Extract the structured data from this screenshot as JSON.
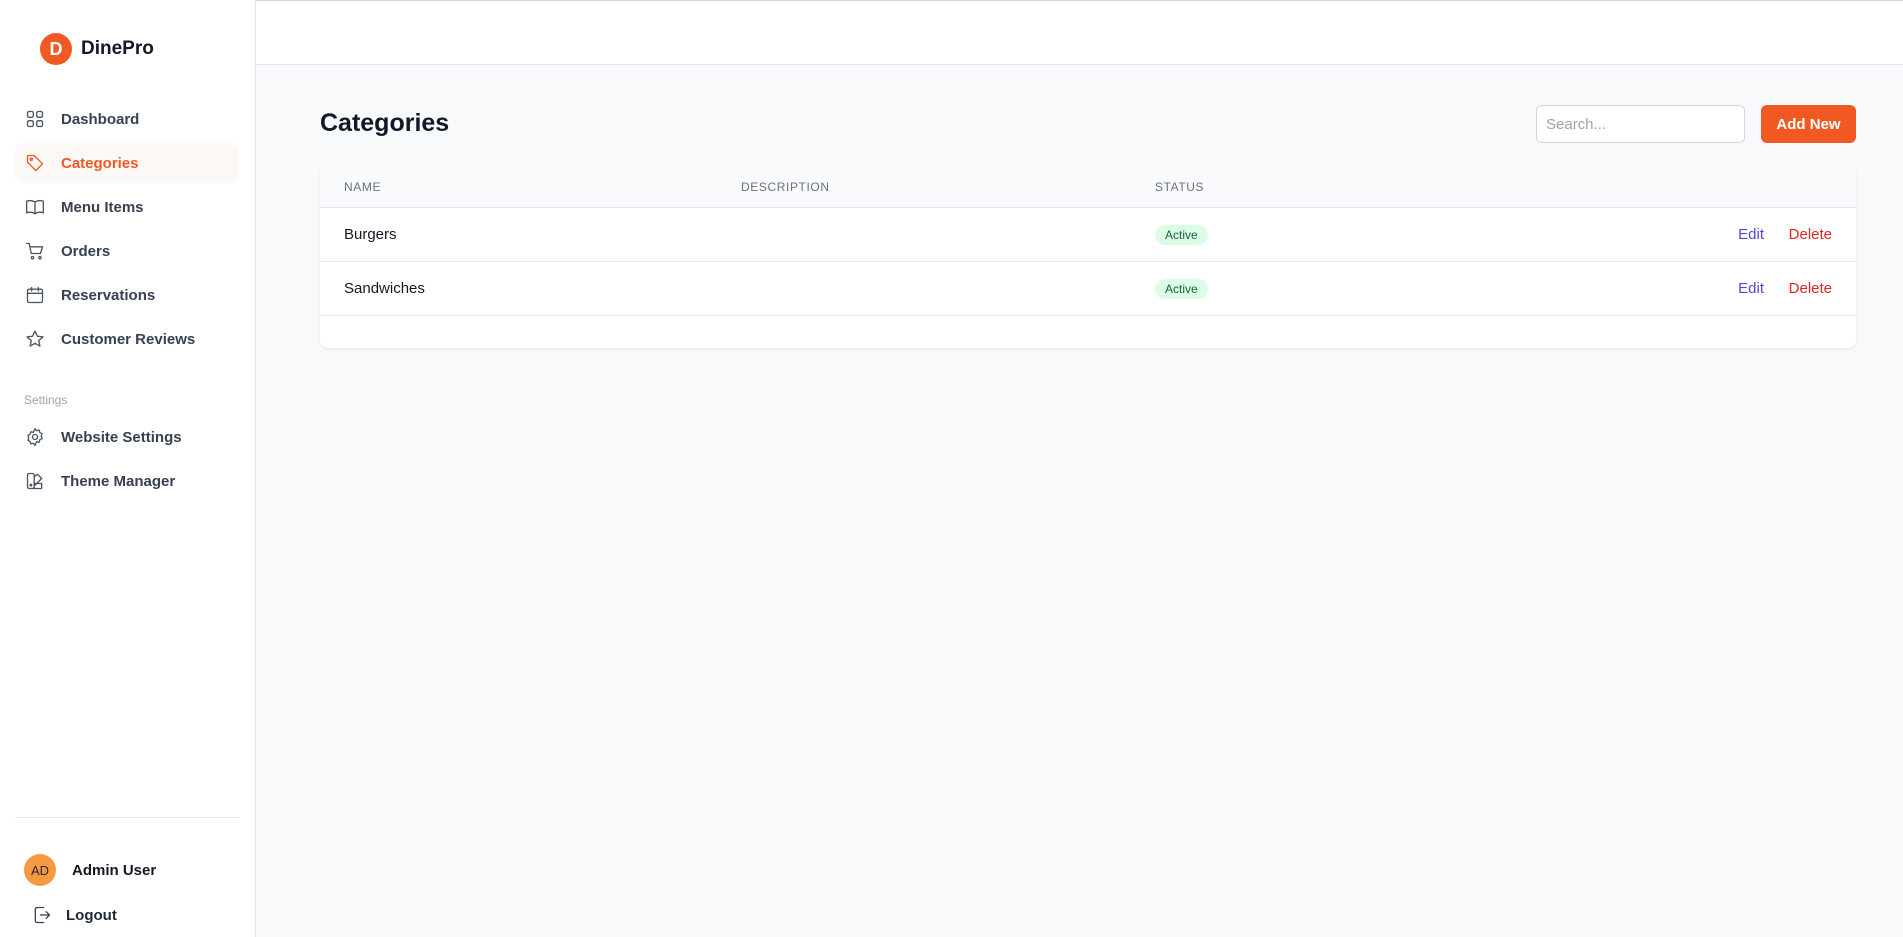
{
  "brand": {
    "logo_letter": "D",
    "name": "DinePro",
    "color": "#f05a22"
  },
  "nav": {
    "items": [
      {
        "label": "Dashboard",
        "icon": "grid-icon",
        "active": false
      },
      {
        "label": "Categories",
        "icon": "tag-icon",
        "active": true
      },
      {
        "label": "Menu Items",
        "icon": "book-icon",
        "active": false
      },
      {
        "label": "Orders",
        "icon": "cart-icon",
        "active": false
      },
      {
        "label": "Reservations",
        "icon": "calendar-icon",
        "active": false
      },
      {
        "label": "Customer Reviews",
        "icon": "star-icon",
        "active": false
      }
    ],
    "section_label": "Settings",
    "settings_items": [
      {
        "label": "Website Settings",
        "icon": "gear-icon"
      },
      {
        "label": "Theme Manager",
        "icon": "palette-icon"
      }
    ]
  },
  "user": {
    "initials": "AD",
    "name": "Admin User"
  },
  "logout": {
    "label": "Logout"
  },
  "page": {
    "title": "Categories",
    "search_placeholder": "Search...",
    "add_label": "Add New"
  },
  "table": {
    "headers": {
      "name": "Name",
      "description": "Description",
      "status": "Status"
    },
    "rows": [
      {
        "name": "Burgers",
        "description": "",
        "status": "Active",
        "edit": "Edit",
        "delete": "Delete"
      },
      {
        "name": "Sandwiches",
        "description": "",
        "status": "Active",
        "edit": "Edit",
        "delete": "Delete"
      }
    ]
  }
}
